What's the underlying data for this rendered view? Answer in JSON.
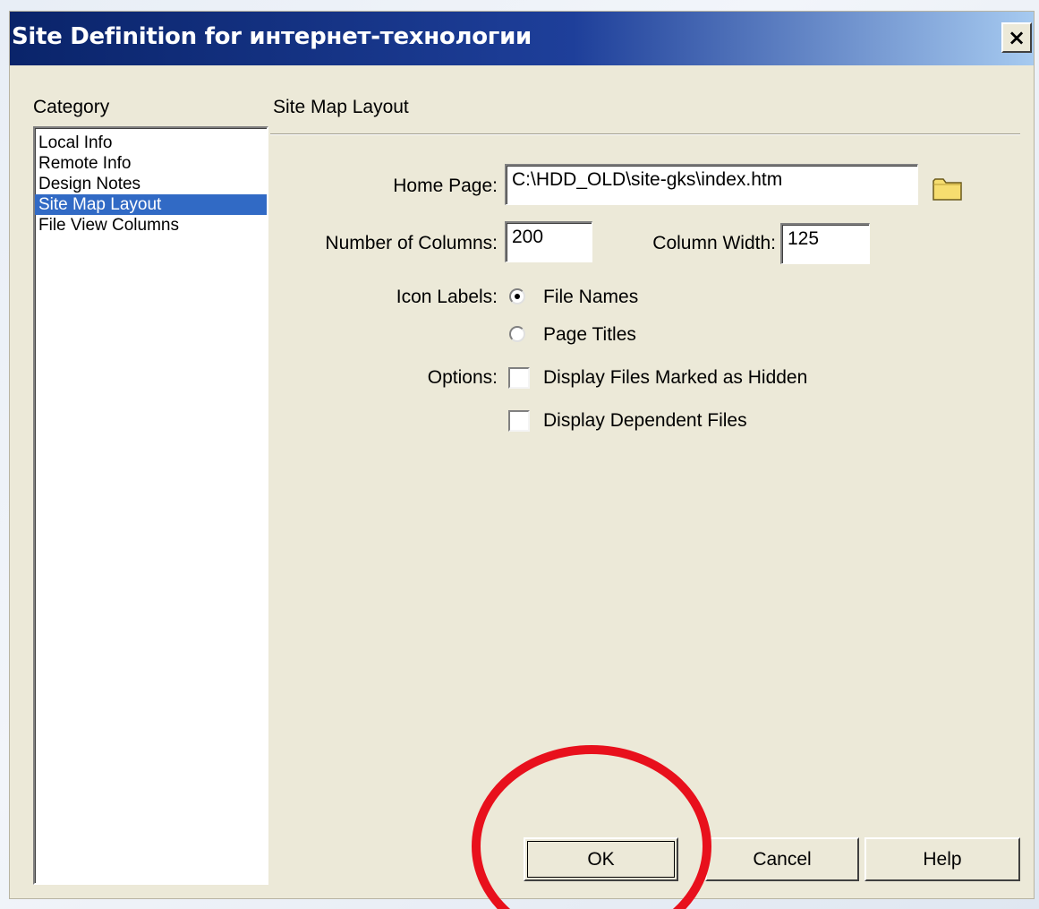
{
  "window": {
    "title": "Site Definition for интернет-технологии",
    "close_symbol": "×"
  },
  "category": {
    "header": "Category",
    "items": [
      {
        "label": "Local Info"
      },
      {
        "label": "Remote Info"
      },
      {
        "label": "Design Notes"
      },
      {
        "label": "Site Map Layout",
        "selected": true
      },
      {
        "label": "File View Columns"
      }
    ]
  },
  "section": {
    "title": "Site Map Layout"
  },
  "form": {
    "home_page_label": "Home Page:",
    "home_page_value": "C:\\HDD_OLD\\site-gks\\index.htm",
    "num_columns_label": "Number of Columns:",
    "num_columns_value": "200",
    "col_width_label": "Column Width:",
    "col_width_value": "125",
    "icon_labels_label": "Icon Labels:",
    "icon_labels_options": [
      {
        "label": "File Names",
        "checked": true
      },
      {
        "label": "Page Titles",
        "checked": false
      }
    ],
    "options_label": "Options:",
    "options": [
      {
        "label": "Display Files Marked as Hidden",
        "checked": false
      },
      {
        "label": "Display Dependent Files",
        "checked": false
      }
    ]
  },
  "buttons": {
    "ok": "OK",
    "cancel": "Cancel",
    "help": "Help"
  },
  "colors": {
    "dialog_bg": "#ece9d8",
    "title_bar_start": "#0a246a",
    "title_bar_end": "#a6caf0",
    "selection": "#316ac5",
    "highlight_circle": "#e8101c",
    "folder_icon": "#f6dd6f"
  }
}
